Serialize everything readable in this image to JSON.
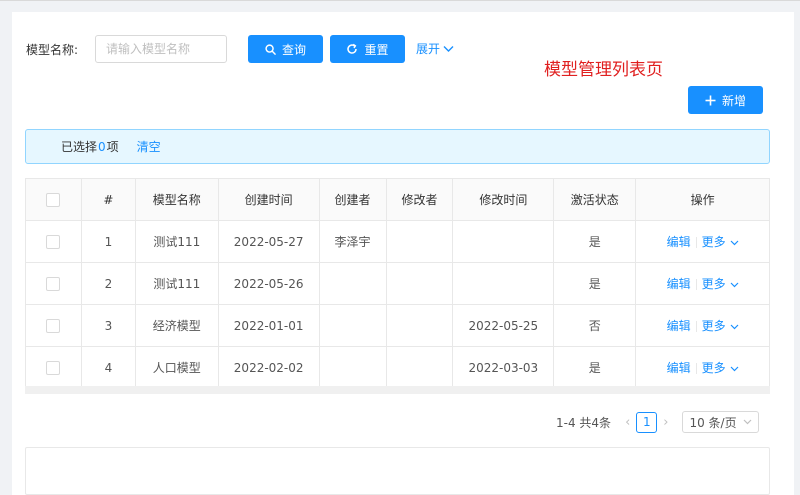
{
  "search": {
    "label": "模型名称:",
    "placeholder": "请输入模型名称",
    "query_label": "查询",
    "reset_label": "重置",
    "expand_label": "展开"
  },
  "annotation": "模型管理列表页",
  "toolbar": {
    "add_label": "新增"
  },
  "selection": {
    "prefix": "已选择",
    "count": "0",
    "suffix": "项",
    "clear_label": "清空"
  },
  "table": {
    "headers": [
      "#",
      "模型名称",
      "创建时间",
      "创建者",
      "修改者",
      "修改时间",
      "激活状态",
      "操作"
    ],
    "rows": [
      {
        "index": "1",
        "name": "测试111",
        "created": "2022-05-27",
        "creator": "李泽宇",
        "modifier": "",
        "modified": "",
        "status": "是"
      },
      {
        "index": "2",
        "name": "测试111",
        "created": "2022-05-26",
        "creator": "",
        "modifier": "",
        "modified": "",
        "status": "是"
      },
      {
        "index": "3",
        "name": "经济模型",
        "created": "2022-01-01",
        "creator": "",
        "modifier": "",
        "modified": "2022-05-25",
        "status": "否"
      },
      {
        "index": "4",
        "name": "人口模型",
        "created": "2022-02-02",
        "creator": "",
        "modifier": "",
        "modified": "2022-03-03",
        "status": "是"
      }
    ],
    "edit_label": "编辑",
    "more_label": "更多"
  },
  "pagination": {
    "summary": "1-4 共4条",
    "current_page": "1",
    "page_size_label": "10 条/页"
  },
  "colors": {
    "primary": "#1890ff",
    "annotation": "#e02020",
    "alert_bg": "#e6f7ff"
  },
  "icons": {
    "query": "search-icon",
    "reset": "reload-icon",
    "add": "plus-icon",
    "expand": "chevron-down-icon"
  }
}
